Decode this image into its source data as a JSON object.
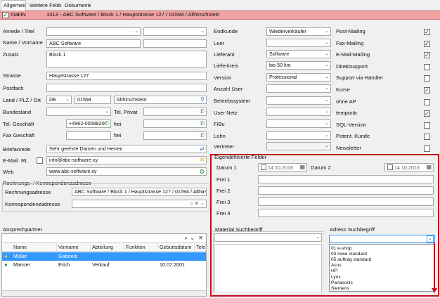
{
  "tabs": {
    "t0": "Allgemein",
    "t1": "Weitere Felder",
    "t2": "Dokumente"
  },
  "banner": {
    "inaktiv": "Inaktiv",
    "address": "1013 - ABC Software / Block 1 / Hauptstrasse 127 / 01594 / Althirschstein"
  },
  "left": {
    "anrede_titel": "Anrede / Titel",
    "name_vorname": "Name / Vorname",
    "name_value": "ABC Software",
    "zusatz": "Zusatz",
    "zusatz_value": "Block 1",
    "strasse": "Strasse",
    "strasse_value": "Hauptstrasse 127",
    "postfach": "Postfach",
    "land_plz_ort": "Land / PLZ / Ort",
    "land_value": "DE",
    "plz_value": "01594",
    "ort_value": "Althirschstein",
    "bundesland": "Bundesland",
    "tel_privat": "Tel. Privat",
    "tel_geschaeft": "Tel. Geschäft",
    "tel_value": "+4962-0008820",
    "frei1": "frei",
    "fax_geschaeft": "Fax Geschäft",
    "frei2": "frei",
    "briefanrede": "Briefanrede",
    "briefanrede_value": "Sehr geehrte Damen und Herren",
    "email": "E-Mail",
    "rl": "RL",
    "email_value": "info@abc-software.xy",
    "web": "Web",
    "web_value": "www.abc-software.xy"
  },
  "rechnung": {
    "group_title": "Rechnungs- / Korrespondenzadresse",
    "rechnungsadresse": "Rechnungsadresse",
    "rechnungs_value": "ABC Software / Block 1 / Hauptstrasse 127 / 01594 / Althirschstein",
    "korrespondenzadresse": "Korrespondenzadresse"
  },
  "ansprech": {
    "title": "Ansprechpartner",
    "columns": {
      "name": "Name",
      "vorname": "Vorname",
      "abteilung": "Abteilung",
      "funktion": "Funktion",
      "geburtsdatum": "Geburtsdatum",
      "tele": "Tele"
    },
    "rows": [
      {
        "name": "Müller",
        "vorname": "Gabriela",
        "abteilung": "",
        "funktion": "",
        "geburtsdatum": ""
      },
      {
        "name": "Manser",
        "vorname": "Erich",
        "abteilung": "Verkauf",
        "funktion": "",
        "geburtsdatum": "10.07.2001"
      }
    ]
  },
  "mid": {
    "endkunde": "Endkunde",
    "endkunde_value": "Wiederverkäufer",
    "leer": "Leer",
    "lieferant": "Lieferant",
    "lieferant_value": "Software",
    "lieferkreis": "Lieferkreis",
    "lieferkreis_value": "bis 50 km",
    "version": "Version",
    "version_value": "Professional",
    "anzahl_user": "Anzahl User",
    "betriebssystem": "Betriebssystem",
    "user_netz": "User Netz",
    "fibu": "FiBu",
    "lohn": "Lohn",
    "vertreter": "Vertreter"
  },
  "right": [
    {
      "label": "Post-Mailing",
      "checked": true
    },
    {
      "label": "Fax-Mailing",
      "checked": true
    },
    {
      "label": "E-Mail-Mailing",
      "checked": true
    },
    {
      "label": "Direktsupport",
      "checked": false
    },
    {
      "label": "Support via Händler",
      "checked": false
    },
    {
      "label": "Kurse",
      "checked": true
    },
    {
      "label": "ohne AP",
      "checked": false
    },
    {
      "label": "temporär",
      "checked": true
    },
    {
      "label": "SQL-Version",
      "checked": false
    },
    {
      "label": "Potent. Kunde",
      "checked": false
    },
    {
      "label": "Newsletter",
      "checked": false
    }
  ],
  "eigen": {
    "title": "Eigendefinierte Felder",
    "datum1": "Datum 1",
    "datum1_value": "14.10.2016",
    "datum2": "Datum 2",
    "datum2_value": "14.10.2016",
    "frei1": "Frei 1",
    "frei2": "Frei 2",
    "frei3": "Frei 3",
    "frei4": "Frei 4"
  },
  "material": {
    "title": "Material Suchbegriff"
  },
  "adress": {
    "title": "Adress Suchbegriff",
    "options": [
      "01 e-shop",
      "03 rewe standard",
      "05 auftrag standard",
      "Asus",
      "HP",
      "Lynx",
      "Panasonic",
      "Siemens"
    ]
  },
  "colors": {
    "banner": "#f0a0a0",
    "highlight": "#c0101e",
    "selection": "#3399ff"
  }
}
